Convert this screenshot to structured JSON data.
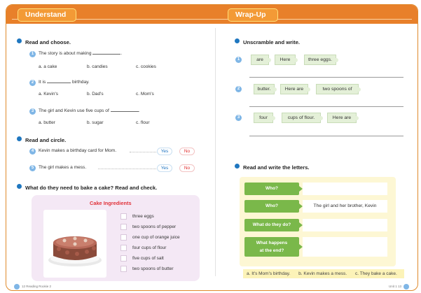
{
  "tabs": {
    "left": "Understand",
    "right": "Wrap-Up"
  },
  "left": {
    "section1": {
      "heading": "Read and choose.",
      "questions": [
        {
          "num": "1",
          "pre": "The story is about making",
          "post": ".",
          "options": [
            "a. a cake",
            "b. candies",
            "c. cookies"
          ]
        },
        {
          "num": "2",
          "pre": "It is",
          "post": "birthday.",
          "options": [
            "a. Kevin's",
            "b. Dad's",
            "c. Mom's"
          ]
        },
        {
          "num": "3",
          "pre": "The girl and Kevin use five cups of",
          "post": ".",
          "options": [
            "a. butter",
            "b. sugar",
            "c. flour"
          ]
        }
      ]
    },
    "section2": {
      "heading": "Read and circle.",
      "items": [
        {
          "num": "4",
          "text": "Kevin makes a birthday card for Mom.",
          "yes": "Yes",
          "no": "No"
        },
        {
          "num": "5",
          "text": "The girl makes a mess.",
          "yes": "Yes",
          "no": "No"
        }
      ]
    },
    "section3": {
      "heading": "What do they need to bake a cake? Read and check.",
      "panel_title": "Cake Ingredients",
      "ingredients": [
        "three eggs",
        "two spoons of pepper",
        "one cup of orange juice",
        "four cups of flour",
        "five cups of salt",
        "two spoons of butter"
      ]
    }
  },
  "right": {
    "section1": {
      "heading": "Unscramble and write.",
      "rows": [
        {
          "num": "1",
          "tiles": [
            "are",
            "Here",
            "three eggs."
          ]
        },
        {
          "num": "2",
          "tiles": [
            "butter.",
            "Here are",
            "two spoons of"
          ]
        },
        {
          "num": "3",
          "tiles": [
            "four",
            "cups of flour.",
            "Here are"
          ]
        }
      ]
    },
    "section2": {
      "heading": "Read and write the letters.",
      "rows": [
        {
          "label": "Who?",
          "answer": ""
        },
        {
          "label": "Who?",
          "answer": "The girl and her brother, Kevin"
        },
        {
          "label": "What do they do?",
          "answer": ""
        },
        {
          "label_line1": "What happens",
          "label_line2": "at the end?",
          "answer": ""
        }
      ],
      "choices": [
        "a. It's Mom's birthday.",
        "b. Kevin makes a mess.",
        "c. They bake a cake."
      ]
    }
  },
  "footer": {
    "left_page": "12",
    "left_text": "Reading Rookie 2",
    "right_text": "Unit 1",
    "right_page": "13"
  },
  "colors": {
    "accent": "#e8802a",
    "bullet": "#1f77c0",
    "green_label": "#7ab84a",
    "panel": "#f4e8f5"
  }
}
